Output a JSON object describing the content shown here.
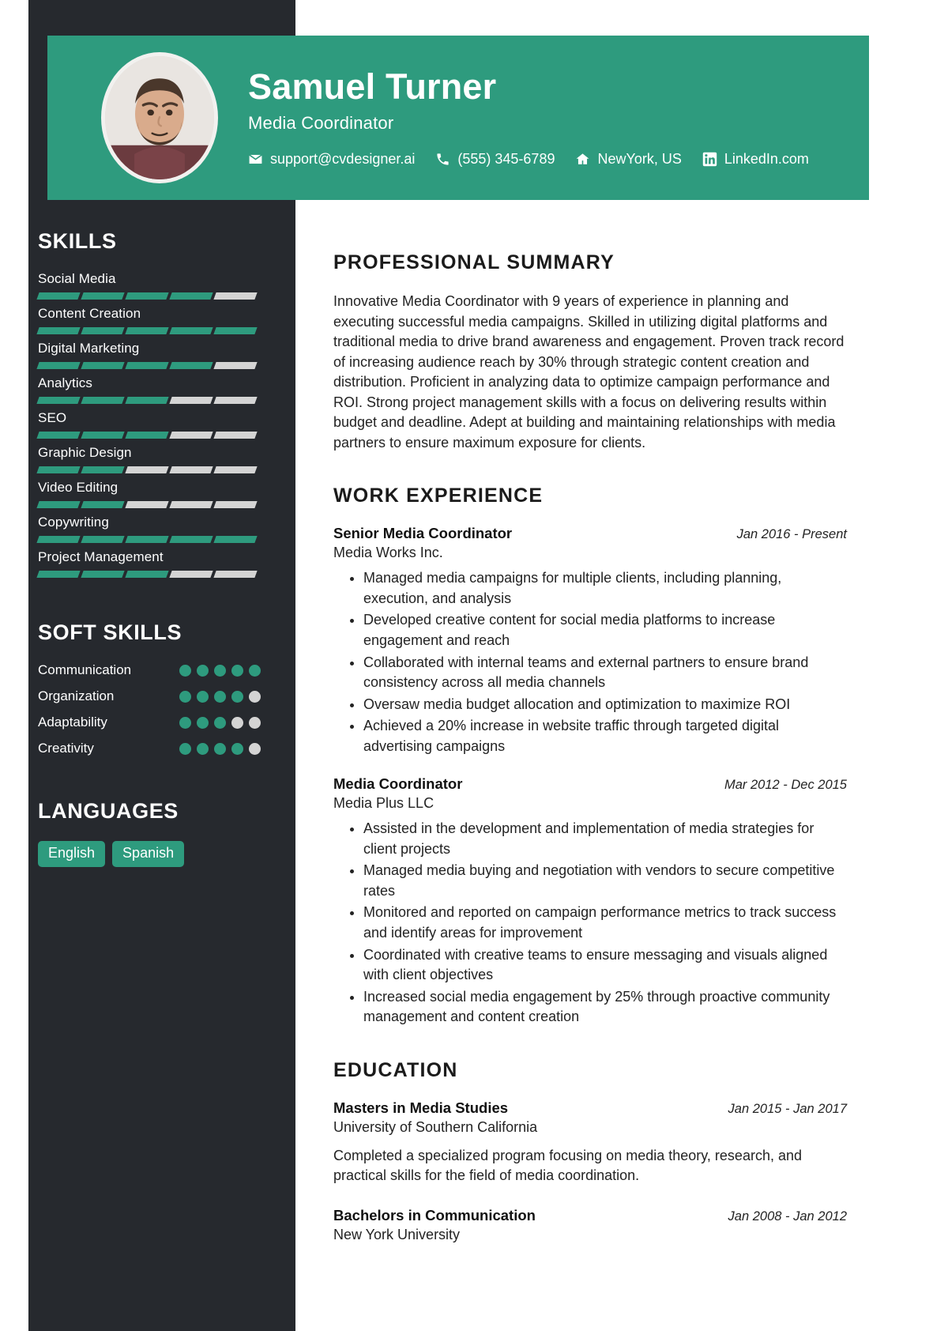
{
  "header": {
    "name": "Samuel Turner",
    "role": "Media Coordinator",
    "accent_color": "#2e9b7e",
    "sidebar_color": "#26292e",
    "contacts": [
      {
        "icon": "envelope-icon",
        "label": "support@cvdesigner.ai"
      },
      {
        "icon": "phone-icon",
        "label": "(555) 345-6789"
      },
      {
        "icon": "home-icon",
        "label": "NewYork, US"
      },
      {
        "icon": "linkedin-icon",
        "label": "LinkedIn.com"
      }
    ]
  },
  "sidebar": {
    "skills_heading": "SKILLS",
    "skills": [
      {
        "name": "Social Media",
        "level": 4,
        "max": 5
      },
      {
        "name": "Content Creation",
        "level": 5,
        "max": 5
      },
      {
        "name": "Digital Marketing",
        "level": 4,
        "max": 5
      },
      {
        "name": "Analytics",
        "level": 3,
        "max": 5
      },
      {
        "name": "SEO",
        "level": 3,
        "max": 5
      },
      {
        "name": "Graphic Design",
        "level": 2,
        "max": 5
      },
      {
        "name": "Video Editing",
        "level": 2,
        "max": 5
      },
      {
        "name": "Copywriting",
        "level": 5,
        "max": 5
      },
      {
        "name": "Project Management",
        "level": 3,
        "max": 5
      }
    ],
    "soft_skills_heading": "SOFT SKILLS",
    "soft_skills": [
      {
        "name": "Communication",
        "level": 5,
        "max": 5
      },
      {
        "name": "Organization",
        "level": 4,
        "max": 5
      },
      {
        "name": "Adaptability",
        "level": 3,
        "max": 5
      },
      {
        "name": "Creativity",
        "level": 4,
        "max": 5
      }
    ],
    "languages_heading": "LANGUAGES",
    "languages": [
      "English",
      "Spanish"
    ]
  },
  "main": {
    "summary_heading": "PROFESSIONAL SUMMARY",
    "summary_text": "Innovative Media Coordinator with 9 years of experience in planning and executing successful media campaigns. Skilled in utilizing digital platforms and traditional media to drive brand awareness and engagement. Proven track record of increasing audience reach by 30% through strategic content creation and distribution. Proficient in analyzing data to optimize campaign performance and ROI. Strong project management skills with a focus on delivering results within budget and deadline. Adept at building and maintaining relationships with media partners to ensure maximum exposure for clients.",
    "experience_heading": "WORK EXPERIENCE",
    "experience": [
      {
        "title": "Senior Media Coordinator",
        "date": "Jan 2016 - Present",
        "company": "Media Works Inc.",
        "bullets": [
          "Managed media campaigns for multiple clients, including planning, execution, and analysis",
          "Developed creative content for social media platforms to increase engagement and reach",
          "Collaborated with internal teams and external partners to ensure brand consistency across all media channels",
          "Oversaw media budget allocation and optimization to maximize ROI",
          "Achieved a 20% increase in website traffic through targeted digital advertising campaigns"
        ]
      },
      {
        "title": "Media Coordinator",
        "date": "Mar 2012 - Dec 2015",
        "company": "Media Plus LLC",
        "bullets": [
          "Assisted in the development and implementation of media strategies for client projects",
          "Managed media buying and negotiation with vendors to secure competitive rates",
          "Monitored and reported on campaign performance metrics to track success and identify areas for improvement",
          "Coordinated with creative teams to ensure messaging and visuals aligned with client objectives",
          "Increased social media engagement by 25% through proactive community management and content creation"
        ]
      }
    ],
    "education_heading": "EDUCATION",
    "education": [
      {
        "degree": "Masters in Media Studies",
        "date": "Jan 2015 - Jan 2017",
        "school": "University of Southern California",
        "description": "Completed a specialized program focusing on media theory, research, and practical skills for the field of media coordination."
      },
      {
        "degree": "Bachelors in Communication",
        "date": "Jan 2008 - Jan 2012",
        "school": "New York University",
        "description": ""
      }
    ]
  }
}
